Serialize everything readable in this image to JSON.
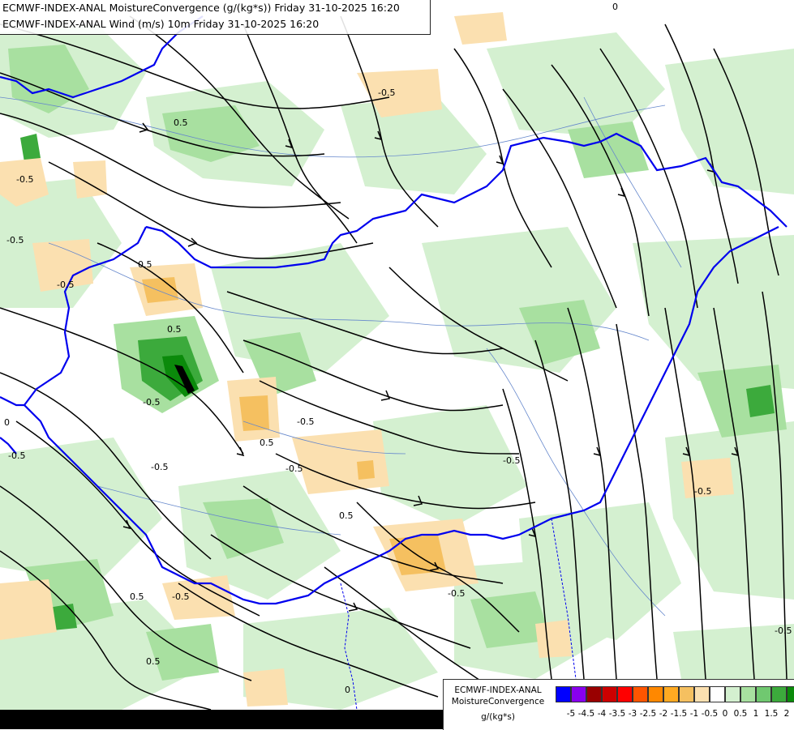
{
  "header": {
    "line1": "ECMWF-INDEX-ANAL MoistureConvergence (g/(kg*s)) Friday 31-10-2025 16:20",
    "line2": "ECMWF-INDEX-ANAL Wind (m/s) 10m Friday 31-10-2025 16:20"
  },
  "legend": {
    "title_line1": "ECMWF-INDEX-ANAL",
    "title_line2": "MoistureConvergence",
    "units": "g/(kg*s)",
    "colors": [
      "#0000ff",
      "#8800ee",
      "#990000",
      "#cc0000",
      "#ff0000",
      "#ff5500",
      "#ff8800",
      "#ffaa22",
      "#f5c060",
      "#fbe0b0",
      "#ffffff",
      "#d4f0d0",
      "#a8e0a0",
      "#70c870",
      "#3caa3c",
      "#0b8a0b"
    ],
    "ticks": [
      "-5",
      "-4.5",
      "-4",
      "-3.5",
      "-3",
      "-2.5",
      "-2",
      "-1.5",
      "-1",
      "-0.5",
      "0",
      "0.5",
      "1",
      "1.5",
      "2"
    ]
  },
  "map": {
    "contour_labels": [
      "-0.5",
      "-0.5",
      "-0.5",
      "-0.5",
      "-0.5",
      "-0.5",
      "-0.5",
      "-0.5",
      "-0.5",
      "-0.5",
      "-0.5",
      "-0.5",
      "0.5",
      "0.5",
      "0.5",
      "0.5",
      "0.5",
      "0.5",
      "0",
      "0",
      "0",
      "-0.5",
      "0.5",
      "-0.5"
    ],
    "colors": {
      "border": "#0000ee",
      "river": "#6688cc",
      "streamline": "#000000",
      "convergence_light": "#d4f0d0",
      "convergence_mid": "#a8e0a0",
      "convergence_strong": "#3caa3c",
      "divergence_light": "#fbe0b0",
      "divergence_mid": "#f5c060"
    }
  }
}
